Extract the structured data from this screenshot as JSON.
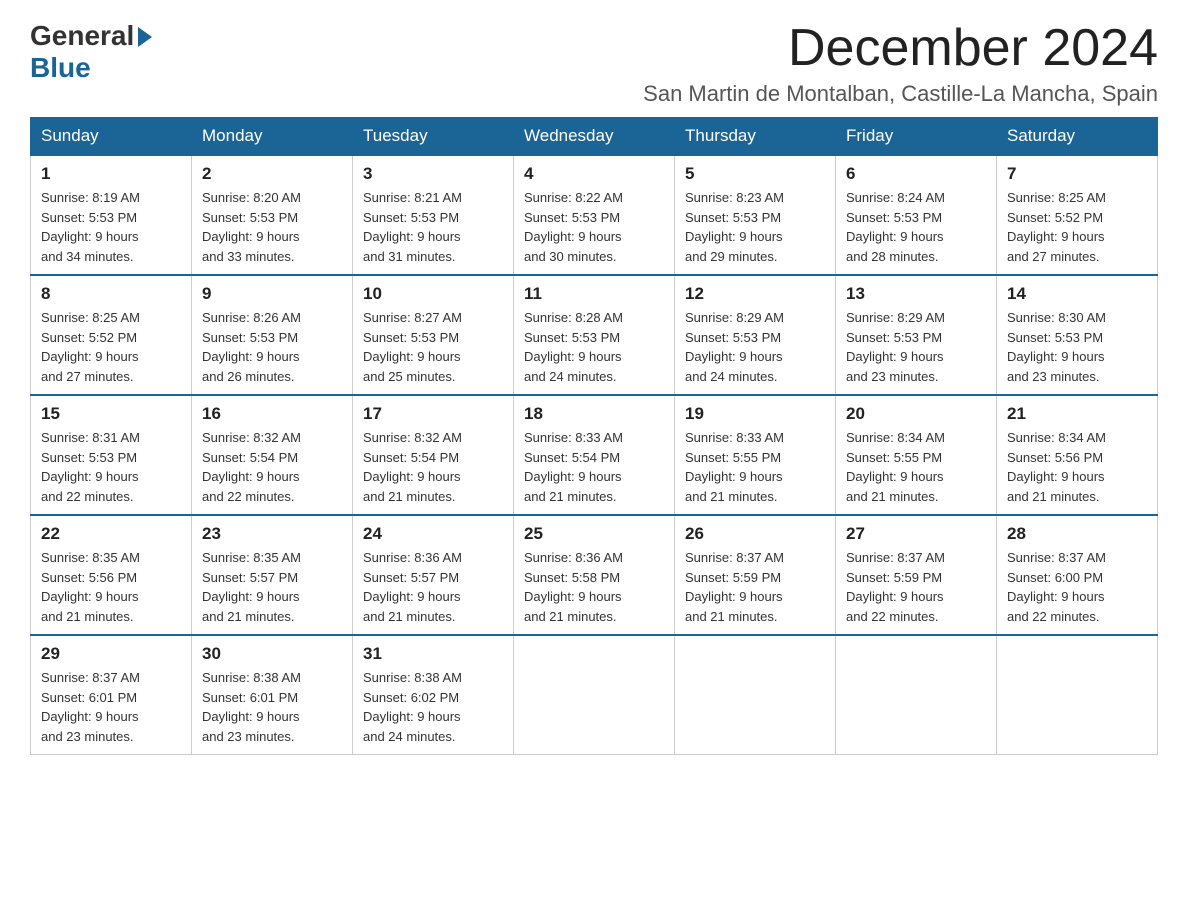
{
  "header": {
    "logo_general": "General",
    "logo_blue": "Blue",
    "month_title": "December 2024",
    "location": "San Martin de Montalban, Castille-La Mancha, Spain"
  },
  "days_of_week": [
    "Sunday",
    "Monday",
    "Tuesday",
    "Wednesday",
    "Thursday",
    "Friday",
    "Saturday"
  ],
  "weeks": [
    [
      {
        "day": "1",
        "sunrise": "8:19 AM",
        "sunset": "5:53 PM",
        "daylight": "9 hours and 34 minutes."
      },
      {
        "day": "2",
        "sunrise": "8:20 AM",
        "sunset": "5:53 PM",
        "daylight": "9 hours and 33 minutes."
      },
      {
        "day": "3",
        "sunrise": "8:21 AM",
        "sunset": "5:53 PM",
        "daylight": "9 hours and 31 minutes."
      },
      {
        "day": "4",
        "sunrise": "8:22 AM",
        "sunset": "5:53 PM",
        "daylight": "9 hours and 30 minutes."
      },
      {
        "day": "5",
        "sunrise": "8:23 AM",
        "sunset": "5:53 PM",
        "daylight": "9 hours and 29 minutes."
      },
      {
        "day": "6",
        "sunrise": "8:24 AM",
        "sunset": "5:53 PM",
        "daylight": "9 hours and 28 minutes."
      },
      {
        "day": "7",
        "sunrise": "8:25 AM",
        "sunset": "5:52 PM",
        "daylight": "9 hours and 27 minutes."
      }
    ],
    [
      {
        "day": "8",
        "sunrise": "8:25 AM",
        "sunset": "5:52 PM",
        "daylight": "9 hours and 27 minutes."
      },
      {
        "day": "9",
        "sunrise": "8:26 AM",
        "sunset": "5:53 PM",
        "daylight": "9 hours and 26 minutes."
      },
      {
        "day": "10",
        "sunrise": "8:27 AM",
        "sunset": "5:53 PM",
        "daylight": "9 hours and 25 minutes."
      },
      {
        "day": "11",
        "sunrise": "8:28 AM",
        "sunset": "5:53 PM",
        "daylight": "9 hours and 24 minutes."
      },
      {
        "day": "12",
        "sunrise": "8:29 AM",
        "sunset": "5:53 PM",
        "daylight": "9 hours and 24 minutes."
      },
      {
        "day": "13",
        "sunrise": "8:29 AM",
        "sunset": "5:53 PM",
        "daylight": "9 hours and 23 minutes."
      },
      {
        "day": "14",
        "sunrise": "8:30 AM",
        "sunset": "5:53 PM",
        "daylight": "9 hours and 23 minutes."
      }
    ],
    [
      {
        "day": "15",
        "sunrise": "8:31 AM",
        "sunset": "5:53 PM",
        "daylight": "9 hours and 22 minutes."
      },
      {
        "day": "16",
        "sunrise": "8:32 AM",
        "sunset": "5:54 PM",
        "daylight": "9 hours and 22 minutes."
      },
      {
        "day": "17",
        "sunrise": "8:32 AM",
        "sunset": "5:54 PM",
        "daylight": "9 hours and 21 minutes."
      },
      {
        "day": "18",
        "sunrise": "8:33 AM",
        "sunset": "5:54 PM",
        "daylight": "9 hours and 21 minutes."
      },
      {
        "day": "19",
        "sunrise": "8:33 AM",
        "sunset": "5:55 PM",
        "daylight": "9 hours and 21 minutes."
      },
      {
        "day": "20",
        "sunrise": "8:34 AM",
        "sunset": "5:55 PM",
        "daylight": "9 hours and 21 minutes."
      },
      {
        "day": "21",
        "sunrise": "8:34 AM",
        "sunset": "5:56 PM",
        "daylight": "9 hours and 21 minutes."
      }
    ],
    [
      {
        "day": "22",
        "sunrise": "8:35 AM",
        "sunset": "5:56 PM",
        "daylight": "9 hours and 21 minutes."
      },
      {
        "day": "23",
        "sunrise": "8:35 AM",
        "sunset": "5:57 PM",
        "daylight": "9 hours and 21 minutes."
      },
      {
        "day": "24",
        "sunrise": "8:36 AM",
        "sunset": "5:57 PM",
        "daylight": "9 hours and 21 minutes."
      },
      {
        "day": "25",
        "sunrise": "8:36 AM",
        "sunset": "5:58 PM",
        "daylight": "9 hours and 21 minutes."
      },
      {
        "day": "26",
        "sunrise": "8:37 AM",
        "sunset": "5:59 PM",
        "daylight": "9 hours and 21 minutes."
      },
      {
        "day": "27",
        "sunrise": "8:37 AM",
        "sunset": "5:59 PM",
        "daylight": "9 hours and 22 minutes."
      },
      {
        "day": "28",
        "sunrise": "8:37 AM",
        "sunset": "6:00 PM",
        "daylight": "9 hours and 22 minutes."
      }
    ],
    [
      {
        "day": "29",
        "sunrise": "8:37 AM",
        "sunset": "6:01 PM",
        "daylight": "9 hours and 23 minutes."
      },
      {
        "day": "30",
        "sunrise": "8:38 AM",
        "sunset": "6:01 PM",
        "daylight": "9 hours and 23 minutes."
      },
      {
        "day": "31",
        "sunrise": "8:38 AM",
        "sunset": "6:02 PM",
        "daylight": "9 hours and 24 minutes."
      },
      null,
      null,
      null,
      null
    ]
  ]
}
